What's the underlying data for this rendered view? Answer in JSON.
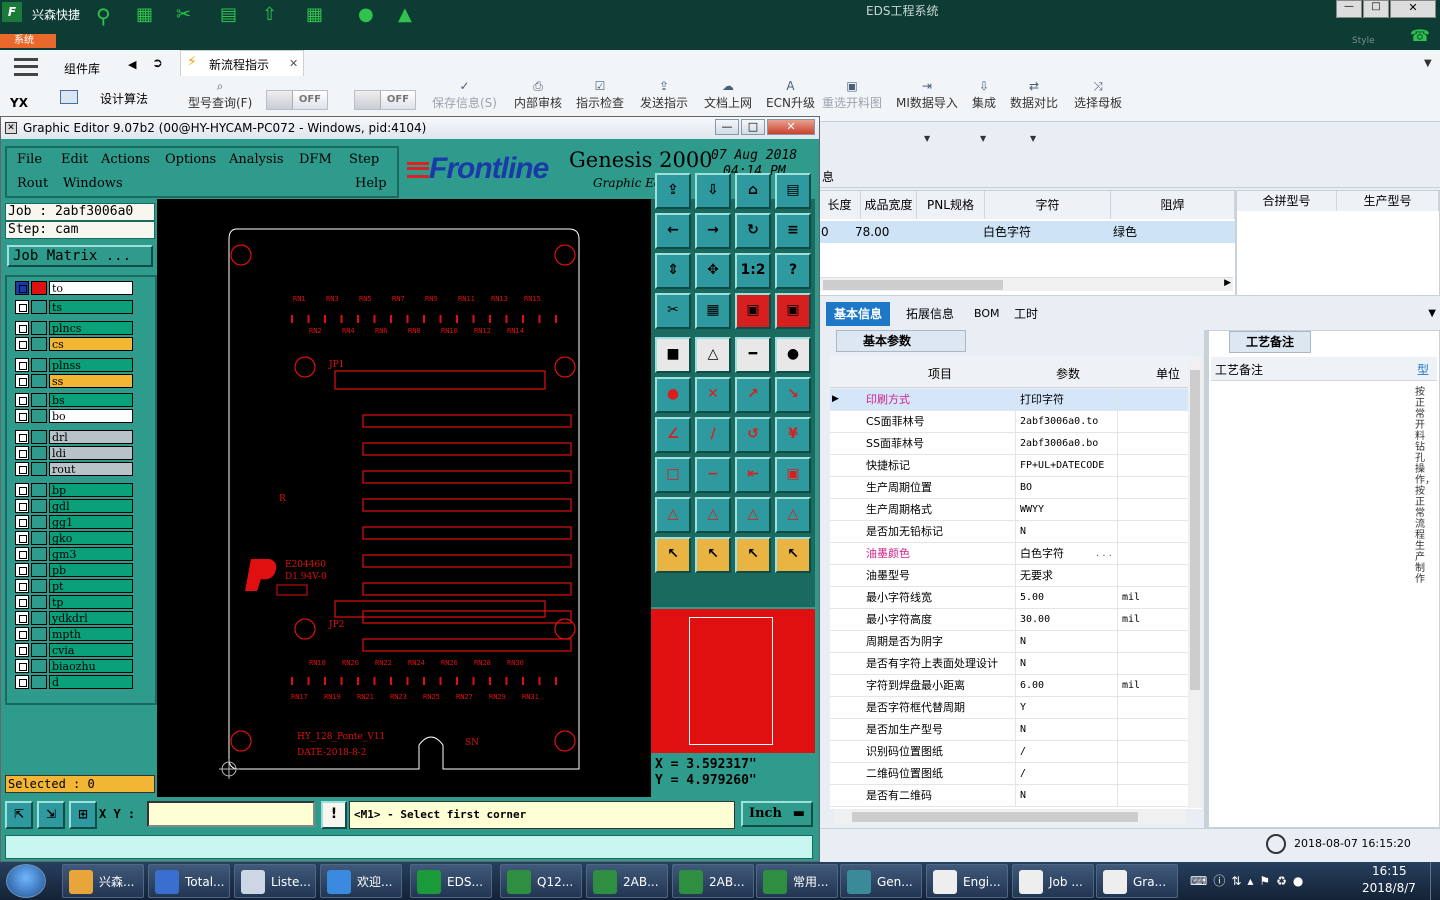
{
  "eds": {
    "app_title": "EDS工程系统",
    "shortcut_label": "兴森快捷",
    "system_tag": "系统",
    "brand_small": "Style",
    "yx_label": "YX",
    "side_items": [
      "组件库",
      "设计算法"
    ],
    "active_tab": "新流程指示",
    "toggle_off": "OFF",
    "ribbon": [
      {
        "label": "型号查询(F)",
        "icon": "search-icon"
      },
      {
        "label": "保存信息(S)",
        "icon": "check-icon"
      },
      {
        "label": "内部审核",
        "icon": "printer-icon"
      },
      {
        "label": "指示检查",
        "icon": "check-box-icon"
      },
      {
        "label": "发送指示",
        "icon": "upload-icon"
      },
      {
        "label": "文档上网",
        "icon": "cloud-icon"
      },
      {
        "label": "ECN升级",
        "icon": "ecn-icon"
      },
      {
        "label": "重选开料图",
        "icon": "image-icon"
      },
      {
        "label": "MI数据导入",
        "icon": "import-icon"
      },
      {
        "label": "集成",
        "icon": "download-icon"
      },
      {
        "label": "数据对比",
        "icon": "compare-icon"
      },
      {
        "label": "选择母板",
        "icon": "shuffle-icon"
      }
    ],
    "section_label": "息",
    "grid_headers": [
      "长度",
      "成品宽度",
      "PNL规格",
      "字符",
      "阻焊",
      "合拼型号",
      "生产型号"
    ],
    "grid_row": {
      "c0": "0",
      "c1": "78.00",
      "c2": "",
      "c3": "白色字符",
      "c4": "绿色"
    },
    "info_tabs": [
      "基本信息",
      "拓展信息",
      "BOM",
      "工时"
    ],
    "basic_params_tab": "基本参数",
    "param_headers": {
      "item": "项目",
      "value": "参数",
      "unit": "单位"
    },
    "params": [
      {
        "k": "印刷方式",
        "v": "打印字符",
        "u": "",
        "highlight": true
      },
      {
        "k": "CS面菲林号",
        "v": "2abf3006a0.to",
        "u": ""
      },
      {
        "k": "SS面菲林号",
        "v": "2abf3006a0.bo",
        "u": ""
      },
      {
        "k": "快捷标记",
        "v": "FP+UL+DATECODE",
        "u": ""
      },
      {
        "k": "生产周期位置",
        "v": "BO",
        "u": ""
      },
      {
        "k": "生产周期格式",
        "v": "WWYY",
        "u": ""
      },
      {
        "k": "是否加无铅标记",
        "v": "N",
        "u": ""
      },
      {
        "k": "油墨颜色",
        "v": "白色字符",
        "u": "",
        "pink": true
      },
      {
        "k": "油墨型号",
        "v": "无要求",
        "u": ""
      },
      {
        "k": "最小字符线宽",
        "v": "5.00",
        "u": "mil"
      },
      {
        "k": "最小字符高度",
        "v": "30.00",
        "u": "mil"
      },
      {
        "k": "周期是否为阴字",
        "v": "N",
        "u": ""
      },
      {
        "k": "是否有字符上表面处理设计",
        "v": "N",
        "u": ""
      },
      {
        "k": "字符到焊盘最小距离",
        "v": "6.00",
        "u": "mil"
      },
      {
        "k": "是否字符框代替周期",
        "v": "Y",
        "u": ""
      },
      {
        "k": "是否加生产型号",
        "v": "N",
        "u": ""
      },
      {
        "k": "识别码位置图纸",
        "v": "/",
        "u": ""
      },
      {
        "k": "二维码位置图纸",
        "v": "/",
        "u": ""
      },
      {
        "k": "是否有二维码",
        "v": "N",
        "u": ""
      }
    ],
    "process_tab": "工艺备注",
    "process_col": "工艺备注",
    "side_col": "型",
    "vertical_note": "按正常开料钻孔操作，按正常流程生产制作",
    "timestamp": "2018-08-07  16:15:20",
    "ellipsis": ". . ."
  },
  "ge": {
    "title": "Graphic Editor 9.07b2 (00@HY-HYCAM-PC072 - Windows, pid:4104)",
    "menu_row1": [
      "File",
      "Edit",
      "Actions",
      "Options",
      "Analysis",
      "DFM",
      "Step"
    ],
    "menu_row2": [
      "Rout",
      "Windows",
      "Help"
    ],
    "brand": "Frontline",
    "product": "Genesis 2000",
    "subtitle": "Graphic Editor",
    "date": "07 Aug 2018",
    "time": "04:14 PM",
    "job": "Job : 2abf3006a0",
    "step": "Step: cam",
    "job_matrix": "Job Matrix ...",
    "layers": [
      {
        "name": "to",
        "color": "#ffffff",
        "active": true
      },
      {
        "name": "ts",
        "color": "#0aa07a"
      },
      {
        "name": "plncs",
        "color": "#0aa07a"
      },
      {
        "name": "cs",
        "color": "#f2b534"
      },
      {
        "name": "plnss",
        "color": "#0aa07a"
      },
      {
        "name": "ss",
        "color": "#f2b534"
      },
      {
        "name": "bs",
        "color": "#0aa07a"
      },
      {
        "name": "bo",
        "color": "#ffffff"
      },
      {
        "name": "drl",
        "color": "#b7c3c8"
      },
      {
        "name": "ldi",
        "color": "#b7c3c8"
      },
      {
        "name": "rout",
        "color": "#b7c3c8"
      },
      {
        "name": "bp",
        "color": "#0aa07a"
      },
      {
        "name": "gdl",
        "color": "#0aa07a"
      },
      {
        "name": "gg1",
        "color": "#0aa07a"
      },
      {
        "name": "gko",
        "color": "#0aa07a"
      },
      {
        "name": "gm3",
        "color": "#0aa07a"
      },
      {
        "name": "pb",
        "color": "#0aa07a"
      },
      {
        "name": "pt",
        "color": "#0aa07a"
      },
      {
        "name": "tp",
        "color": "#0aa07a"
      },
      {
        "name": "ydkdrl",
        "color": "#0aa07a"
      },
      {
        "name": "mpth",
        "color": "#0aa07a"
      },
      {
        "name": "cvia",
        "color": "#0aa07a"
      },
      {
        "name": "biaozhu",
        "color": "#0aa07a"
      },
      {
        "name": "d",
        "color": "#0aa07a"
      }
    ],
    "selected": "Selected : 0",
    "xy_label": "X Y :",
    "xy_value": "",
    "status": "<M1> - Select first corner",
    "unit": "Inch",
    "x_readout": "X  =  3.592317\"",
    "y_readout": "Y  =  4.979260\"",
    "board": {
      "rn_top_a": [
        "RN1",
        "RN3",
        "RN5",
        "RN7",
        "RN9",
        "RN11",
        "RN13",
        "RN15"
      ],
      "rn_top_b": [
        "RN2",
        "RN4",
        "RN6",
        "RN8",
        "RN10",
        "RN12",
        "RN14"
      ],
      "rn_bot_a": [
        "RN18",
        "RN20",
        "RN22",
        "RN24",
        "RN26",
        "RN28",
        "RN30"
      ],
      "rn_bot_b": [
        "RN17",
        "RN19",
        "RN21",
        "RN23",
        "RN25",
        "RN27",
        "RN29",
        "RN31"
      ],
      "jp1": "JP1",
      "jp2": "JP2",
      "ref_r": "R",
      "ul_code": "E204460",
      "ul_grade": "D1 94V-0",
      "board_name": "HY_128_Ponte_V11",
      "board_date": "DATE-2018-8-2",
      "sn": "SN"
    }
  },
  "taskbar": {
    "items": [
      "兴森...",
      "Total...",
      "Liste...",
      "欢迎...",
      "EDS...",
      "Q12...",
      "2AB...",
      "2AB...",
      "常用...",
      "Gen...",
      "Engi...",
      "Job ...",
      "Gra..."
    ],
    "time": "16:15",
    "date": "2018/8/7"
  }
}
